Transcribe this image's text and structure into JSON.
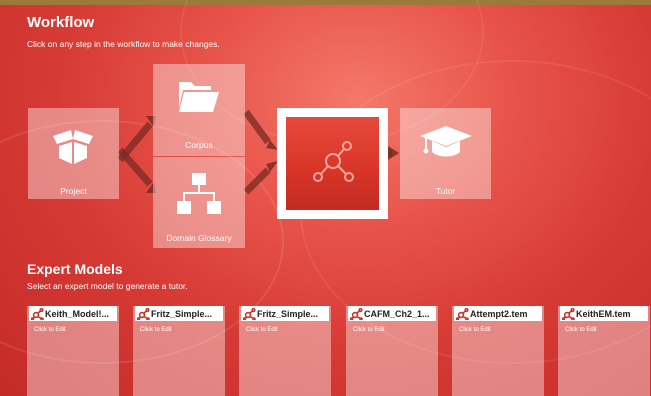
{
  "workflow": {
    "title": "Workflow",
    "subtitle": "Click on any step in the workflow to make changes."
  },
  "steps": {
    "project": {
      "label": "Project",
      "icon": "box-icon"
    },
    "corpus": {
      "label": "Corpus",
      "icon": "folder-icon"
    },
    "glossary": {
      "label": "Domain Glossary",
      "icon": "hierarchy-icon"
    },
    "model": {
      "label": "",
      "icon": "network-node-icon"
    },
    "tutor": {
      "label": "Tutor",
      "icon": "graduation-cap-icon"
    }
  },
  "expert_models": {
    "title": "Expert Models",
    "subtitle": "Select an expert model to generate a tutor.",
    "cards": [
      {
        "name": "Keith_Model!...",
        "action": "Click to Edit"
      },
      {
        "name": "Fritz_Simple...",
        "action": "Click to Edit"
      },
      {
        "name": "Fritz_Simple...",
        "action": "Click to Edit"
      },
      {
        "name": "CAFM_Ch2_1...",
        "action": "Click to Edit"
      },
      {
        "name": "Attempt2.tem",
        "action": "Click to Edit"
      },
      {
        "name": "KeithEM.tem",
        "action": "Click to Edit"
      }
    ]
  },
  "colors": {
    "background": "#d63a34",
    "selected_step": "#e64a3c",
    "card_icon": "#d03024"
  }
}
